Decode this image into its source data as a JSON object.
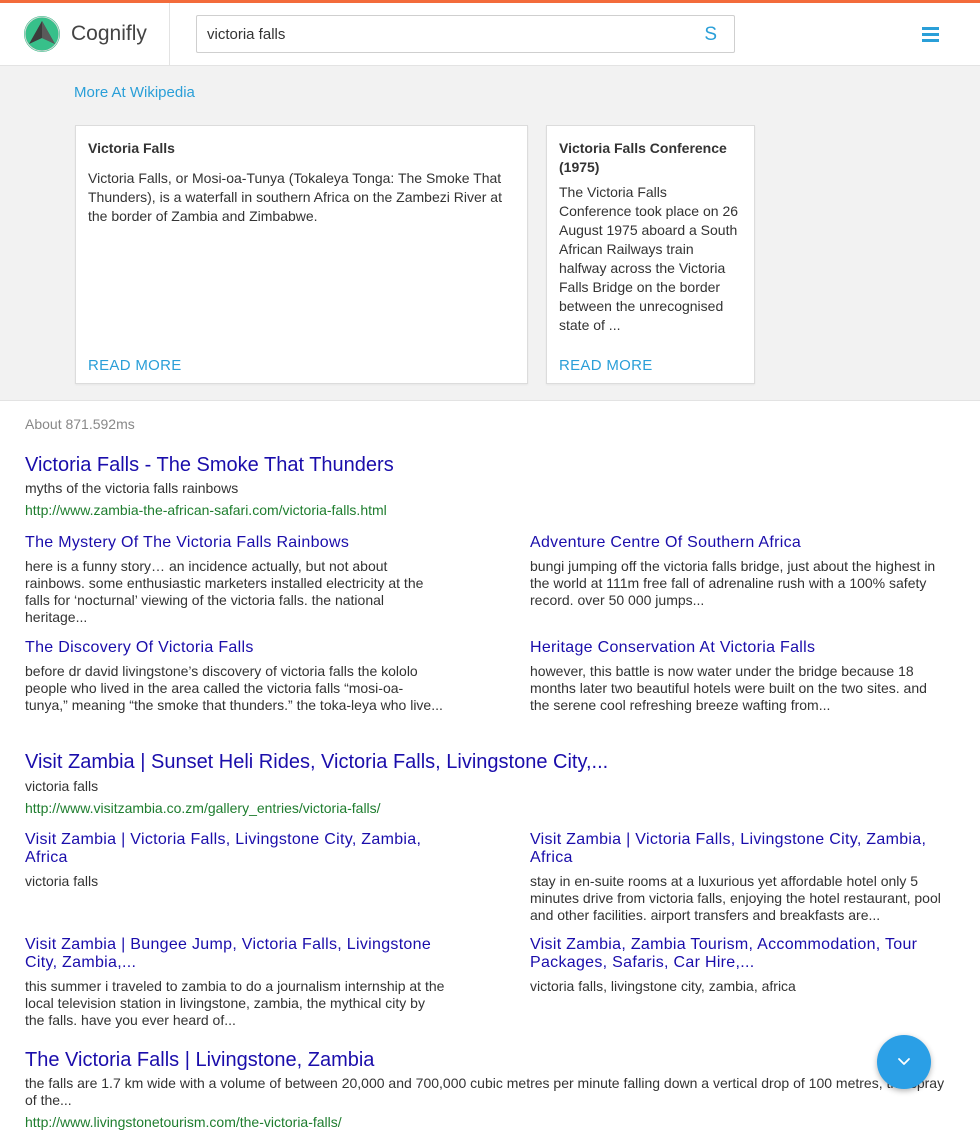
{
  "header": {
    "brand": "Cognifly",
    "search_value": "victoria falls",
    "search_icon_glyph": "S",
    "accent_color": "#2a9fd8",
    "topline_color": "#f36b3b"
  },
  "wiki": {
    "more_link": "More At Wikipedia",
    "cards": [
      {
        "title": "Victoria Falls",
        "text": "Victoria Falls, or Mosi-oa-Tunya (Tokaleya Tonga: The Smoke That Thunders), is a waterfall in southern Africa on the Zambezi River at the border of Zambia and Zimbabwe.",
        "read_more": "READ MORE"
      },
      {
        "title": "Victoria Falls Conference (1975)",
        "text": "The Victoria Falls Conference took place on 26 August 1975 aboard a South African Railways train halfway across the Victoria Falls Bridge on the border between the unrecognised state of ...",
        "read_more": "READ MORE"
      }
    ]
  },
  "timing": "About 871.592ms",
  "results": [
    {
      "title": "Victoria Falls - The Smoke That Thunders",
      "snippet": "myths of the victoria falls rainbows",
      "url": "http://www.zambia-the-african-safari.com/victoria-falls.html",
      "subs": [
        {
          "title": "The Mystery Of The Victoria Falls Rainbows",
          "snippet": "here is a funny story… an incidence actually, but not about rainbows. some enthusiastic marketers installed electricity at the falls for ‘nocturnal’ viewing of the victoria falls. the national heritage..."
        },
        {
          "title": "Adventure Centre Of Southern Africa",
          "snippet": "bungi jumping off the victoria falls bridge, just about the highest in the world at 111m free fall of adrenaline rush with a 100% safety record. over 50 000 jumps..."
        },
        {
          "title": "The Discovery Of Victoria Falls",
          "snippet": "before dr david livingstone’s discovery of victoria falls the kololo people who lived in the area called the victoria falls “mosi-oa-tunya,” meaning “the smoke that thunders.” the toka-leya who live..."
        },
        {
          "title": "Heritage Conservation At Victoria Falls",
          "snippet": "however, this battle is now water under the bridge because 18 months later two beautiful hotels were built on the two sites. and the serene cool refreshing breeze wafting from..."
        }
      ]
    },
    {
      "title": "Visit Zambia | Sunset Heli Rides, Victoria Falls, Livingstone City,...",
      "snippet": "victoria falls",
      "url": "http://www.visitzambia.co.zm/gallery_entries/victoria-falls/",
      "subs": [
        {
          "title": "Visit Zambia | Victoria Falls, Livingstone City, Zambia, Africa",
          "snippet": "victoria falls"
        },
        {
          "title": "Visit Zambia | Victoria Falls, Livingstone City, Zambia, Africa",
          "snippet": "stay in en-suite rooms at a luxurious yet affordable hotel only 5 minutes drive from victoria falls, enjoying the hotel restaurant, pool and other facilities. airport transfers and breakfasts are..."
        },
        {
          "title": "Visit Zambia | Bungee Jump, Victoria Falls, Livingstone City, Zambia,...",
          "snippet": "this summer i traveled to zambia to do a journalism internship at the local television station in livingstone, zambia, the mythical city by the falls. have you ever heard of..."
        },
        {
          "title": "Visit Zambia, Zambia Tourism, Accommodation, Tour Packages, Safaris, Car Hire,...",
          "snippet": "victoria falls, livingstone city, zambia, africa"
        }
      ]
    },
    {
      "title": "The Victoria Falls | Livingstone, Zambia",
      "snippet": "the falls are 1.7 km wide with a volume of between 20,000 and 700,000 cubic metres per minute falling down a vertical drop of 100 metres, the spray of the...",
      "url": "http://www.livingstonetourism.com/the-victoria-falls/"
    }
  ]
}
